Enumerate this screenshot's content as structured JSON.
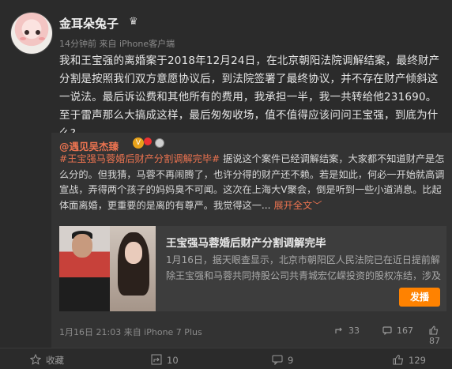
{
  "post": {
    "username": "金耳朵兔子",
    "meta": "14分钟前 来自 iPhone客户端",
    "text": "我和王宝强的离婚案于2018年12月24日，在北京朝阳法院调解结案，最终财产分割是按照我们双方意愿协议后，到法院签署了最终协议，并不存在财产倾斜这一说法。最后诉讼费和其他所有的费用，我承担一半，我一共转给他231690。至于雷声那么大搞成这样，最后匆匆收场，值不值得应该问问王宝强，到底为什么?"
  },
  "repost": {
    "author": "@遇见吴杰臻",
    "hashtag": "#王宝强马蓉婚后财产分割调解完毕#",
    "text": " 据说这个案件已经调解结案，大家都不知道财产是怎么分的。但我猜，马蓉不再闹腾了，也许分得的财产还不赖。若是如此，何必一开始就高调宣战，弄得两个孩子的妈妈臭不可闻。这次在上海大V聚会，倒是听到一些小道消息。比起体面离婚，更重要的是离的有尊严。我觉得这一...",
    "expand": "展开全文",
    "expand_arrow": "﹀",
    "card": {
      "title": "王宝强马蓉婚后财产分割调解完毕",
      "desc": "1月16日，据天眼查显示，北京市朝阳区人民法院已在近日提前解除王宝强和马蓉共同持股公司共青城宏亿嵘投资的股权冻结，涉及",
      "button": "发播"
    },
    "footer_meta": "1月16日 21:03 来自 iPhone 7 Plus",
    "shares": "33",
    "comments": "167",
    "likes": "87"
  },
  "actions": {
    "favorite": "收藏",
    "share": "10",
    "comment": "9",
    "like": "129"
  },
  "colors": {
    "accent": "#eb7350",
    "button": "#ff8200",
    "background": "#2b2b2b"
  }
}
